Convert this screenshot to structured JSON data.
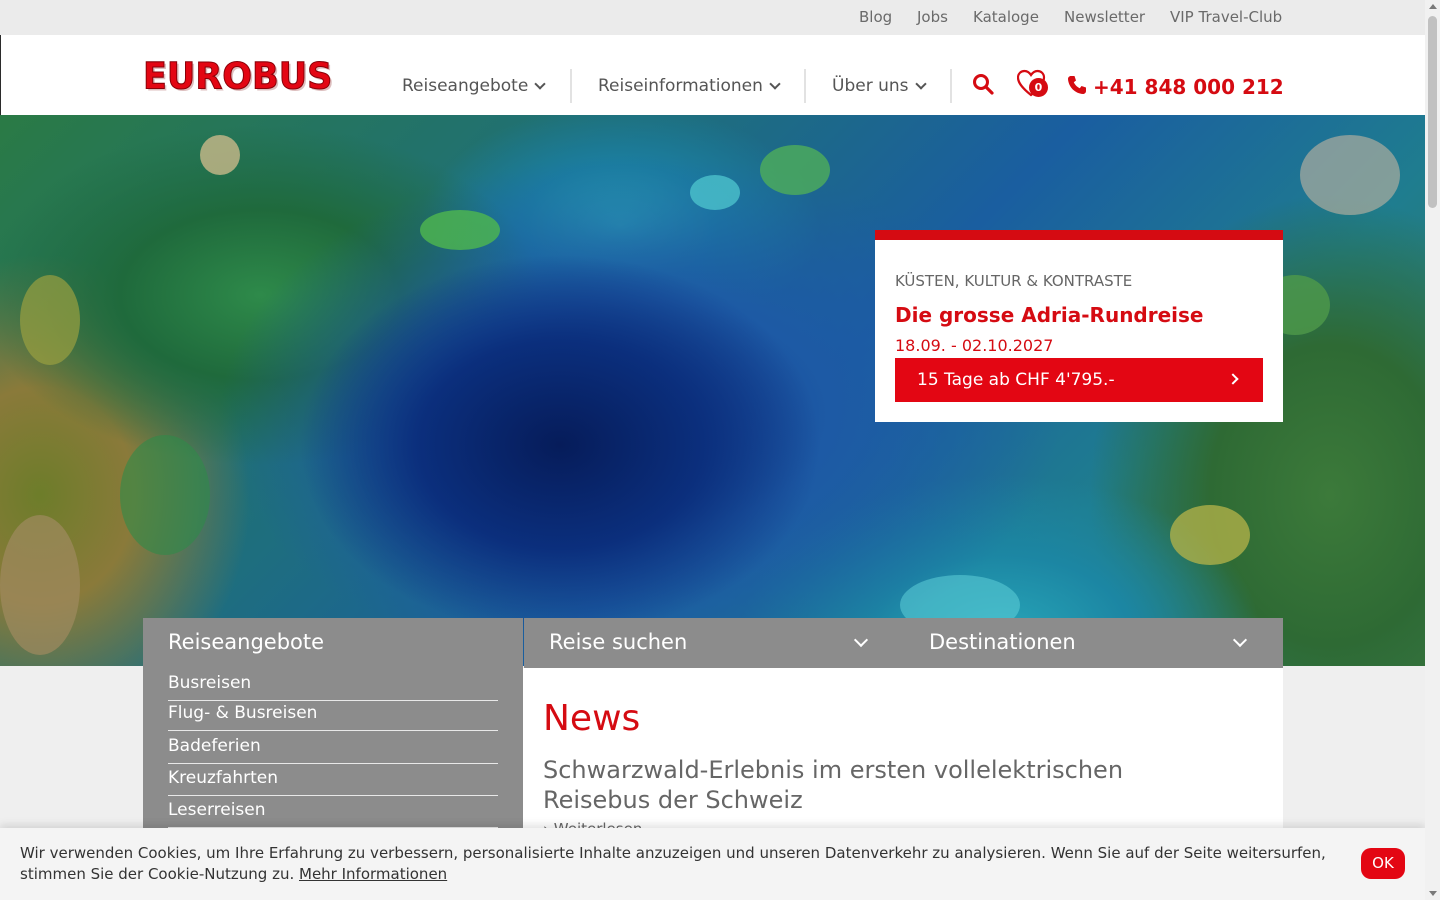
{
  "topbar": {
    "links": [
      "Blog",
      "Jobs",
      "Kataloge",
      "Newsletter",
      "VIP Travel-Club"
    ]
  },
  "header": {
    "logo_text": "EUROBUS",
    "nav": [
      "Reiseangebote",
      "Reiseinformationen",
      "Über uns"
    ],
    "wishlist_count": "0",
    "phone": "+41 848 000 212"
  },
  "promo": {
    "eyebrow": "KÜSTEN, KULTUR & KONTRASTE",
    "title": "Die grosse Adria-Rundreise",
    "date": "18.09. - 02.10.2027",
    "cta": "15 Tage ab CHF 4'795.-"
  },
  "offers": {
    "title": "Reiseangebote",
    "items": [
      "Busreisen",
      "Flug- & Busreisen",
      "Badeferien",
      "Kreuzfahrten",
      "Leserreisen"
    ]
  },
  "tabs": {
    "search": "Reise suchen",
    "destinations": "Destinationen"
  },
  "news": {
    "title": "News",
    "headline": "Schwarzwald-Erlebnis im ersten vollelektrischen Reisebus der Schweiz",
    "more": "› Weiterlesen"
  },
  "cookie": {
    "text": "Wir verwenden Cookies, um Ihre Erfahrung zu verbessern, personalisierte Inhalte anzuzeigen und unseren Datenverkehr zu analysieren. Wenn Sie auf der Seite weitersurfen, stimmen Sie der Cookie-Nutzung zu.",
    "link": "Mehr Informationen",
    "ok": "OK"
  },
  "colors": {
    "brand_red": "#e30613",
    "panel_grey": "#8c8c8c",
    "topbar_grey": "#ebebeb"
  },
  "icons": [
    "search-icon",
    "heart-icon",
    "phone-icon",
    "chevron-down-icon",
    "chevron-right-icon"
  ]
}
